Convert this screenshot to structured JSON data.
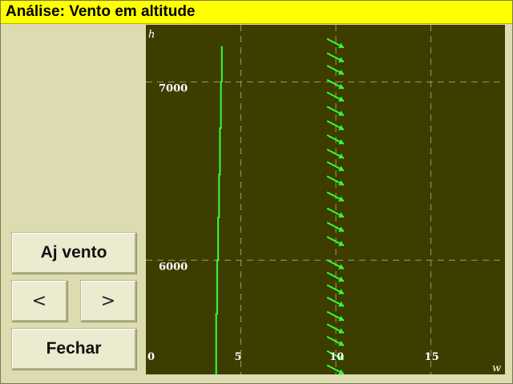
{
  "window": {
    "title": "Análise: Vento em altitude"
  },
  "buttons": {
    "wind": "Aj vento",
    "prev": "<",
    "next": ">",
    "close": "Fechar"
  },
  "chart_data": {
    "type": "line",
    "title": "",
    "xlabel": "w",
    "ylabel": "h",
    "xlim": [
      0,
      18.9
    ],
    "ylim": [
      5360,
      7320
    ],
    "x_ticks": [
      "0",
      "5",
      "10",
      "15"
    ],
    "y_ticks": [
      "6000",
      "7000"
    ],
    "grid": true,
    "colors": {
      "background": "#3d3d00",
      "series": "#33ff33",
      "grid": "#9a9a6a",
      "label": "#ffffff"
    },
    "series": [
      {
        "type": "line",
        "points": [
          {
            "w": 3.7,
            "h": 5360
          },
          {
            "w": 3.7,
            "h": 5700
          },
          {
            "w": 3.75,
            "h": 5700
          },
          {
            "w": 3.75,
            "h": 6000
          },
          {
            "w": 3.8,
            "h": 6000
          },
          {
            "w": 3.8,
            "h": 6240
          },
          {
            "w": 3.85,
            "h": 6240
          },
          {
            "w": 3.85,
            "h": 6480
          },
          {
            "w": 3.9,
            "h": 6480
          },
          {
            "w": 3.9,
            "h": 6740
          },
          {
            "w": 3.95,
            "h": 6740
          },
          {
            "w": 3.95,
            "h": 7000
          },
          {
            "w": 4.0,
            "h": 7000
          },
          {
            "w": 4.0,
            "h": 7200
          }
        ]
      },
      {
        "type": "wind-arrows",
        "w": 10.0,
        "direction": "south-east",
        "h_levels": [
          5380,
          5460,
          5540,
          5610,
          5680,
          5760,
          5830,
          5900,
          5970,
          6100,
          6180,
          6260,
          6350,
          6440,
          6520,
          6590,
          6670,
          6750,
          6830,
          6910,
          6980,
          7060,
          7130,
          7210
        ]
      }
    ]
  }
}
